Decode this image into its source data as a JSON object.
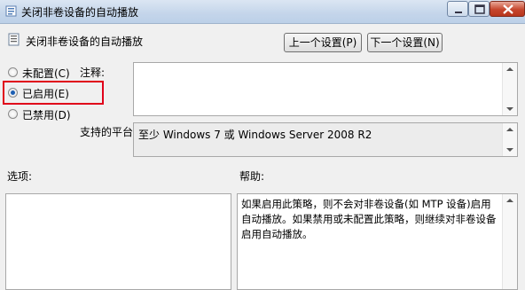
{
  "window": {
    "title": "关闭非卷设备的自动播放"
  },
  "header": {
    "policy_name": "关闭非卷设备的自动播放",
    "prev_button": "上一个设置(P)",
    "next_button": "下一个设置(N)"
  },
  "options": {
    "not_configured": "未配置(C)",
    "enabled": "已启用(E)",
    "disabled": "已禁用(D)",
    "selected": "enabled"
  },
  "comment": {
    "label": "注释:",
    "value": ""
  },
  "supported_on": {
    "label": "支持的平台:",
    "value": "至少 Windows 7 或 Windows Server 2008 R2"
  },
  "options_section": {
    "label": "选项:"
  },
  "help_section": {
    "label": "帮助:",
    "text": "如果启用此策略，则不会对非卷设备(如 MTP 设备)启用自动播放。如果禁用或未配置此策略，则继续对非卷设备启用自动播放。"
  },
  "colors": {
    "highlight_border": "#e0001a",
    "title_bar": "#c4d5ea",
    "close_button": "#c6462d"
  }
}
